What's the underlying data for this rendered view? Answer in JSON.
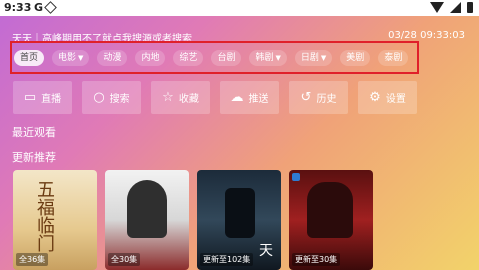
{
  "status_bar": {
    "time": "9:33",
    "g_label": "G"
  },
  "ticker": {
    "text": "天天｜高峰期用不了就点我搜源或者搜索"
  },
  "clock": {
    "datetime": "03/28 09:33:03"
  },
  "categories": [
    {
      "label": "首页",
      "has_arrow": false,
      "active": true
    },
    {
      "label": "电影",
      "has_arrow": true
    },
    {
      "label": "动漫",
      "has_arrow": false
    },
    {
      "label": "内地",
      "has_arrow": false
    },
    {
      "label": "综艺",
      "has_arrow": false
    },
    {
      "label": "台剧",
      "has_arrow": false
    },
    {
      "label": "韩剧",
      "has_arrow": true
    },
    {
      "label": "日剧",
      "has_arrow": true
    },
    {
      "label": "美剧",
      "has_arrow": false
    },
    {
      "label": "泰剧",
      "has_arrow": false
    }
  ],
  "actions": [
    {
      "label": "直播",
      "icon": "tv-icon",
      "glyph": "▭"
    },
    {
      "label": "搜索",
      "icon": "search-icon",
      "glyph": "○"
    },
    {
      "label": "收藏",
      "icon": "star-icon",
      "glyph": "☆"
    },
    {
      "label": "推送",
      "icon": "cloud-upload-icon",
      "glyph": "☁"
    },
    {
      "label": "历史",
      "icon": "history-icon",
      "glyph": "↺"
    },
    {
      "label": "设置",
      "icon": "gear-icon",
      "glyph": "⚙"
    }
  ],
  "sections": {
    "recent": "最近观看",
    "recommended": "更新推荐"
  },
  "posters": [
    {
      "badge": "全36集",
      "glyph": "五福临门"
    },
    {
      "badge": "全30集"
    },
    {
      "badge": "更新至102集",
      "glyph": "天"
    },
    {
      "badge": "更新至30集"
    }
  ],
  "colors": {
    "highlight_border": "#e0202a"
  }
}
